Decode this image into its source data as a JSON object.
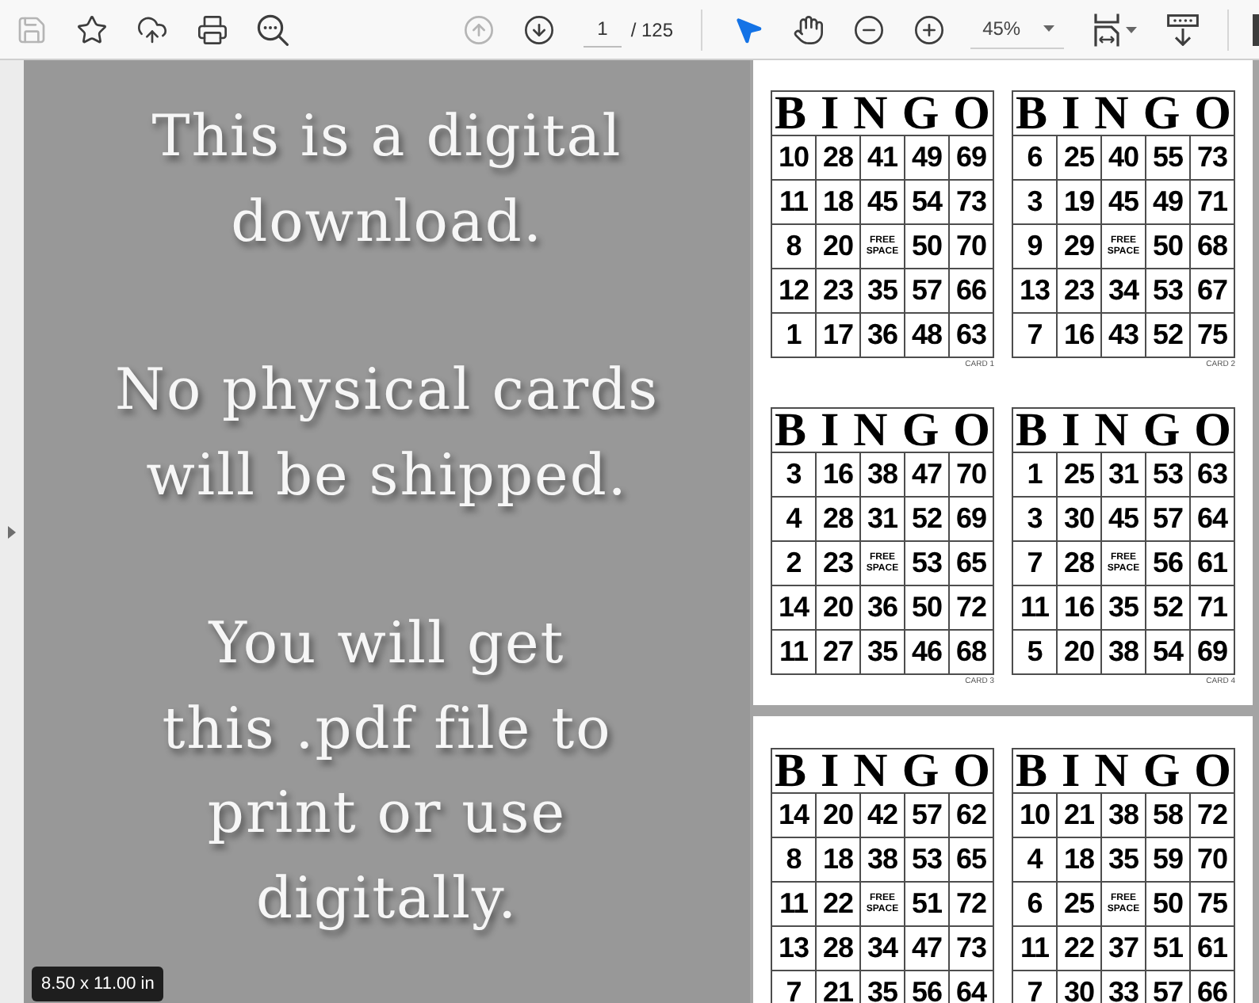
{
  "toolbar": {
    "file_tools": [
      {
        "kind": "save",
        "disabled": true
      },
      {
        "kind": "bookmark",
        "disabled": false
      },
      {
        "kind": "upload",
        "disabled": false
      },
      {
        "kind": "print",
        "disabled": false
      },
      {
        "kind": "find",
        "disabled": false
      }
    ],
    "page_nav": [
      {
        "kind": "previous",
        "disabled": true
      },
      {
        "kind": "next",
        "disabled": false
      }
    ],
    "page_number": "1",
    "page_count": "/ 125",
    "tools": [
      {
        "kind": "select",
        "selected": true
      },
      {
        "kind": "hand",
        "selected": false
      }
    ],
    "zoom_buttons": [
      {
        "kind": "zoom_out"
      },
      {
        "kind": "zoom_in"
      }
    ],
    "zoom": "45%",
    "view_tools": [
      {
        "kind": "page_fit"
      },
      {
        "kind": "scroll_mode"
      }
    ]
  },
  "cover_page": {
    "paragraphs": [
      [
        "This is a digital",
        "download."
      ],
      [
        "No physical cards",
        "will be shipped."
      ],
      [
        "You will get",
        "this .pdf file to",
        "print or use",
        "digitally."
      ]
    ],
    "page_size": "8.50 x 11.00 in"
  },
  "card_pages": [
    {
      "cards": [
        {
          "title": "BINGO",
          "rows": [
            [
              "10",
              "28",
              "41",
              "49",
              "69"
            ],
            [
              "11",
              "18",
              "45",
              "54",
              "73"
            ],
            [
              "8",
              "20",
              "FREE SPACE",
              "50",
              "70"
            ],
            [
              "12",
              "23",
              "35",
              "57",
              "66"
            ],
            [
              "1",
              "17",
              "36",
              "48",
              "63"
            ]
          ],
          "label": "CARD 1"
        },
        {
          "title": "BINGO",
          "rows": [
            [
              "6",
              "25",
              "40",
              "55",
              "73"
            ],
            [
              "3",
              "19",
              "45",
              "49",
              "71"
            ],
            [
              "9",
              "29",
              "FREE SPACE",
              "50",
              "68"
            ],
            [
              "13",
              "23",
              "34",
              "53",
              "67"
            ],
            [
              "7",
              "16",
              "43",
              "52",
              "75"
            ]
          ],
          "label": "CARD 2"
        },
        {
          "title": "BINGO",
          "rows": [
            [
              "3",
              "16",
              "38",
              "47",
              "70"
            ],
            [
              "4",
              "28",
              "31",
              "52",
              "69"
            ],
            [
              "2",
              "23",
              "FREE SPACE",
              "53",
              "65"
            ],
            [
              "14",
              "20",
              "36",
              "50",
              "72"
            ],
            [
              "11",
              "27",
              "35",
              "46",
              "68"
            ]
          ],
          "label": "CARD 3"
        },
        {
          "title": "BINGO",
          "rows": [
            [
              "1",
              "25",
              "31",
              "53",
              "63"
            ],
            [
              "3",
              "30",
              "45",
              "57",
              "64"
            ],
            [
              "7",
              "28",
              "FREE SPACE",
              "56",
              "61"
            ],
            [
              "11",
              "16",
              "35",
              "52",
              "71"
            ],
            [
              "5",
              "20",
              "38",
              "54",
              "69"
            ]
          ],
          "label": "CARD 4"
        }
      ]
    },
    {
      "cards": [
        {
          "title": "BINGO",
          "rows": [
            [
              "14",
              "20",
              "42",
              "57",
              "62"
            ],
            [
              "8",
              "18",
              "38",
              "53",
              "65"
            ],
            [
              "11",
              "22",
              "FREE SPACE",
              "51",
              "72"
            ],
            [
              "13",
              "28",
              "34",
              "47",
              "73"
            ],
            [
              "7",
              "21",
              "35",
              "56",
              "64"
            ]
          ]
        },
        {
          "title": "BINGO",
          "rows": [
            [
              "10",
              "21",
              "38",
              "58",
              "72"
            ],
            [
              "4",
              "18",
              "35",
              "59",
              "70"
            ],
            [
              "6",
              "25",
              "FREE SPACE",
              "50",
              "75"
            ],
            [
              "11",
              "22",
              "37",
              "51",
              "61"
            ],
            [
              "7",
              "30",
              "33",
              "57",
              "66"
            ]
          ]
        }
      ]
    }
  ]
}
